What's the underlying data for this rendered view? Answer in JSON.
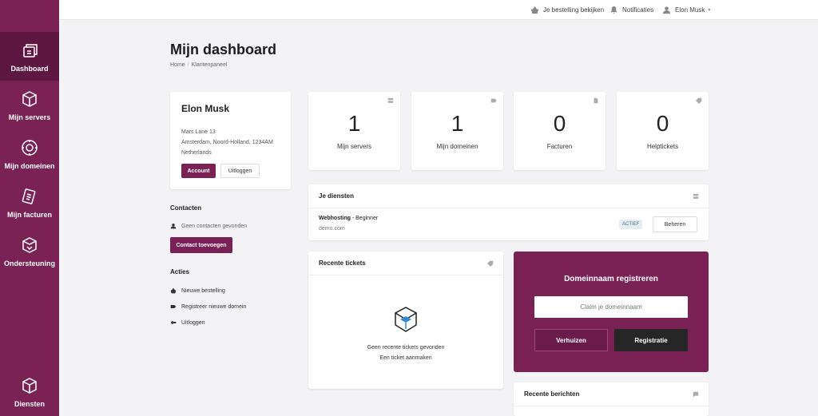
{
  "sidebar": {
    "items": [
      {
        "label": "Dashboard",
        "icon": "dashboard-icon"
      },
      {
        "label": "Mijn servers",
        "icon": "server-box-icon"
      },
      {
        "label": "Mijn domeinen",
        "icon": "globe-icon"
      },
      {
        "label": "Mijn facturen",
        "icon": "invoice-icon"
      },
      {
        "label": "Ondersteuning",
        "icon": "support-box-icon"
      }
    ],
    "bottom_item": {
      "label": "Diensten",
      "icon": "services-box-icon"
    },
    "bg_color": "#7a2155"
  },
  "topbar": {
    "order_link": "Je bestelling bekijken",
    "notifications": "Notificaties",
    "user": "Elon Musk"
  },
  "page": {
    "title": "Mijn dashboard",
    "breadcrumb": [
      "Home",
      "Klantenpaneel"
    ]
  },
  "profile": {
    "name": "Elon Musk",
    "address_lines": [
      "Mars Lane 13",
      "Amsterdam, Noord-Holland, 1234AM",
      "Netherlands"
    ],
    "account_button": "Account",
    "logout_button": "Uitloggen"
  },
  "contacts": {
    "title": "Contacten",
    "empty": "Geen contacten gevonden",
    "add_button": "Contact toevoegen"
  },
  "actions": {
    "title": "Acties",
    "items": [
      "Nieuwe bestelling",
      "Registreer nieuwe domein",
      "Uitloggen"
    ]
  },
  "stats": [
    {
      "value": "1",
      "label": "Mijn servers",
      "icon": "server-icon"
    },
    {
      "value": "1",
      "label": "Mijn domeinen",
      "icon": "tag-icon"
    },
    {
      "value": "0",
      "label": "Facturen",
      "icon": "document-icon"
    },
    {
      "value": "0",
      "label": "Helptickets",
      "icon": "ticket-icon"
    }
  ],
  "services": {
    "title": "Je diensten",
    "item": {
      "name": "Webhosting",
      "plan": " - Beginner",
      "domain": "demo.com",
      "status": "ACTIEF",
      "manage_button": "Beheren"
    }
  },
  "tickets": {
    "title": "Recente tickets",
    "empty": "Geen recente tickets gevonden",
    "create_link": "Een ticket aanmaken"
  },
  "domain_register": {
    "title": "Domeinnaam registreren",
    "placeholder": "Claim je domeinnaam",
    "transfer_button": "Verhuizen",
    "register_button": "Registratie"
  },
  "messages": {
    "title": "Recente berichten"
  },
  "colors": {
    "brand": "#7a2155",
    "brand_dark": "#5e1741",
    "register_button_bg": "#262626"
  }
}
